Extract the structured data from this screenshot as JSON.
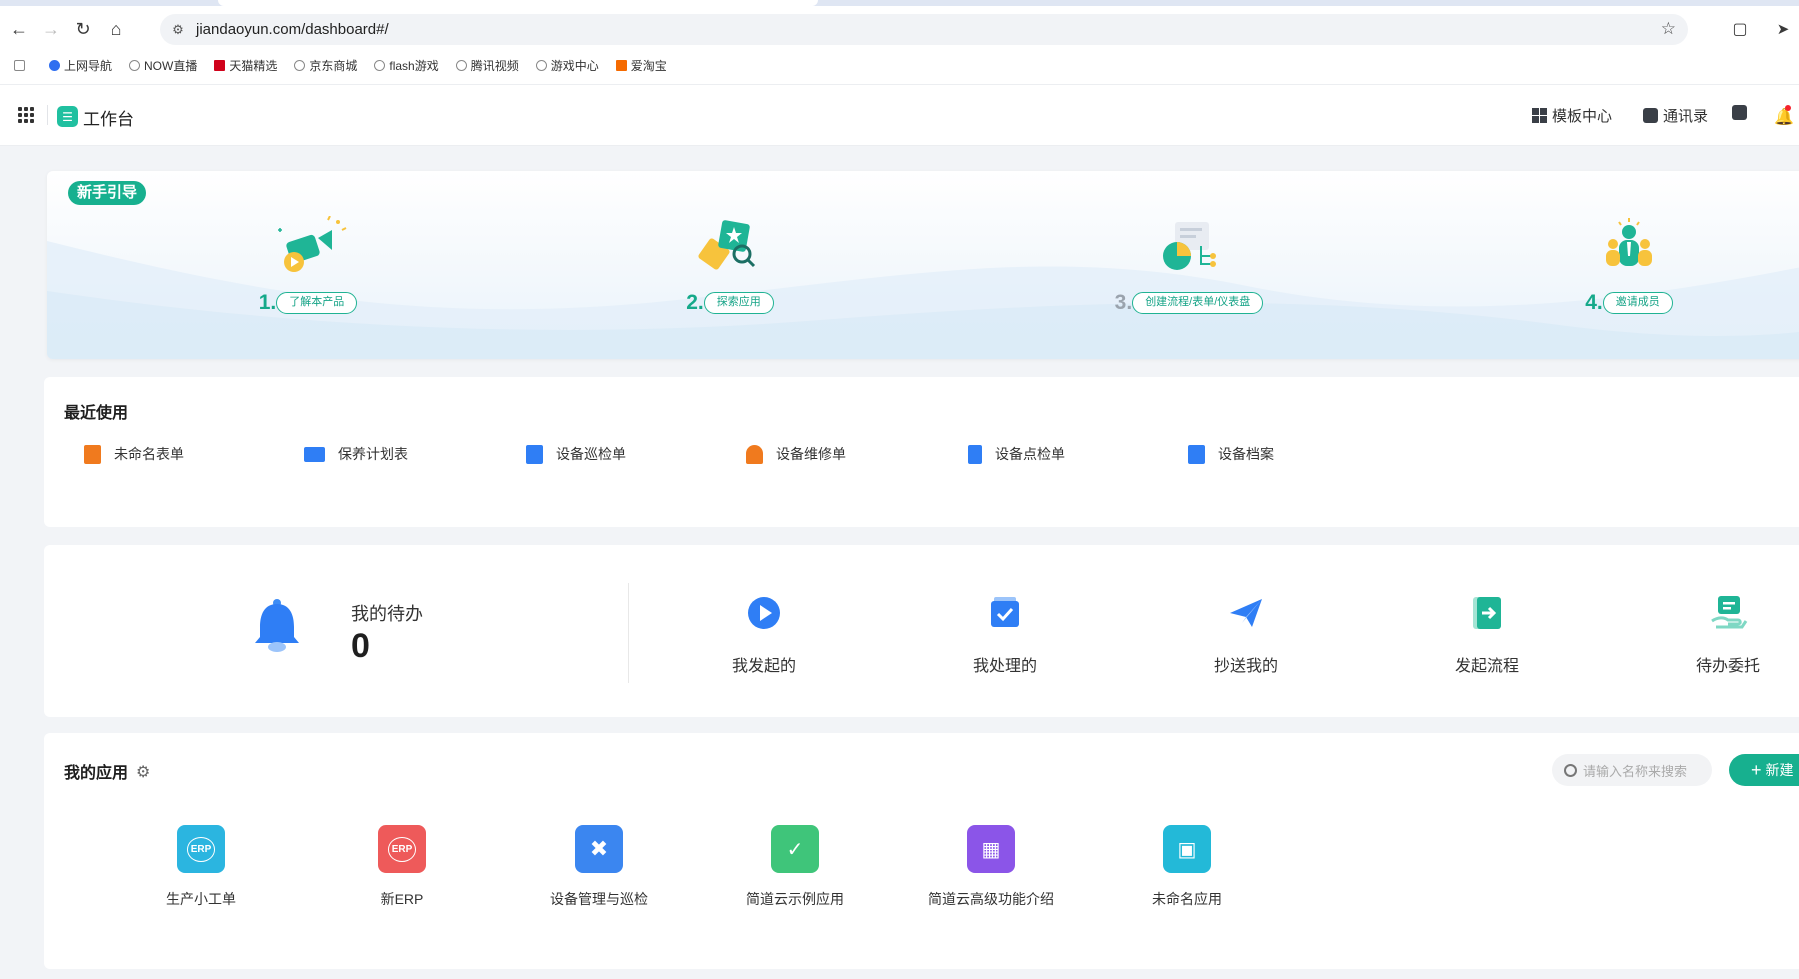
{
  "browser": {
    "url": "jiandaoyun.com/dashboard#/",
    "bookmarks": [
      {
        "label": "上网导航",
        "icon": "search-icon"
      },
      {
        "label": "NOW直播",
        "icon": "globe-icon"
      },
      {
        "label": "天猫精选",
        "icon": "tmall-icon"
      },
      {
        "label": "京东商城",
        "icon": "globe-icon"
      },
      {
        "label": "flash游戏",
        "icon": "globe-icon"
      },
      {
        "label": "腾讯视频",
        "icon": "globe-icon"
      },
      {
        "label": "游戏中心",
        "icon": "globe-icon"
      },
      {
        "label": "爱淘宝",
        "icon": "taobao-icon"
      }
    ]
  },
  "header": {
    "title": "工作台",
    "template_center": "模板中心",
    "contacts": "通讯录"
  },
  "guide": {
    "badge": "新手引导",
    "steps": [
      {
        "num": "1.",
        "label": "了解本产品"
      },
      {
        "num": "2.",
        "label": "探索应用"
      },
      {
        "num": "3.",
        "label": "创建流程/表单/仪表盘"
      },
      {
        "num": "4.",
        "label": "邀请成员"
      }
    ]
  },
  "recent": {
    "title": "最近使用",
    "items": [
      {
        "label": "未命名表单",
        "color": "#f07a1e"
      },
      {
        "label": "保养计划表",
        "color": "#2f7ef5"
      },
      {
        "label": "设备巡检单",
        "color": "#2f7ef5"
      },
      {
        "label": "设备维修单",
        "color": "#f07a1e"
      },
      {
        "label": "设备点检单",
        "color": "#2f7ef5"
      },
      {
        "label": "设备档案",
        "color": "#2f7ef5"
      }
    ]
  },
  "todo": {
    "label": "我的待办",
    "count": "0",
    "actions": [
      {
        "label": "我发起的",
        "icon": "play-icon"
      },
      {
        "label": "我处理的",
        "icon": "check-icon"
      },
      {
        "label": "抄送我的",
        "icon": "send-icon"
      },
      {
        "label": "发起流程",
        "icon": "start-flow-icon"
      },
      {
        "label": "待办委托",
        "icon": "delegate-icon"
      }
    ]
  },
  "myapps": {
    "title": "我的应用",
    "search_placeholder": "请输入名称来搜索",
    "new_label": "新建",
    "apps": [
      {
        "label": "生产小工单",
        "badge": "ERP",
        "color": "#2bb5e0"
      },
      {
        "label": "新ERP",
        "badge": "ERP",
        "color": "#ee5a5a"
      },
      {
        "label": "设备管理与巡检",
        "badge": "",
        "color": "#3b86f0"
      },
      {
        "label": "简道云示例应用",
        "badge": "",
        "color": "#3fc57a"
      },
      {
        "label": "简道云高级功能介绍",
        "badge": "",
        "color": "#8b55e8"
      },
      {
        "label": "未命名应用",
        "badge": "",
        "color": "#23b9d8"
      }
    ]
  }
}
